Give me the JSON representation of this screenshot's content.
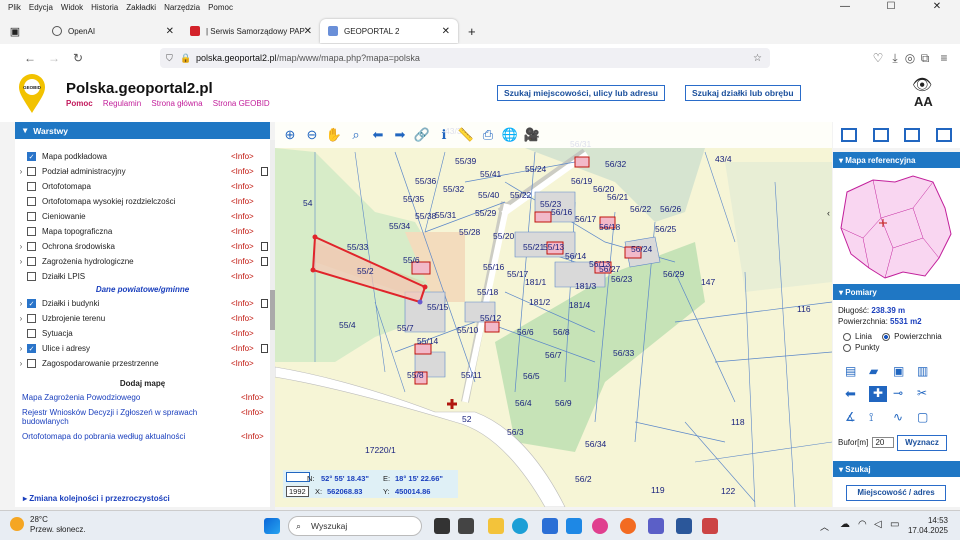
{
  "menu": [
    "Plik",
    "Edycja",
    "Widok",
    "Historia",
    "Zakładki",
    "Narzędzia",
    "Pomoc"
  ],
  "window_controls": {
    "minimize": "—",
    "maximize": "☐",
    "close": "✕"
  },
  "tabs": [
    {
      "label": "OpenAI",
      "close": "✕"
    },
    {
      "label": "| Serwis Samorządowy PAP",
      "close": "✕"
    },
    {
      "label": "GEOPORTAL 2",
      "close": "✕"
    }
  ],
  "new_tab": "+",
  "url": {
    "host": "polska.geoportal2.pl",
    "path": "/map/www/mapa.php?mapa=polska"
  },
  "header": {
    "logo_text": "GEOBID",
    "title": "Polska.geoportal2.pl",
    "links": [
      "Pomoc",
      "Regulamin",
      "Strona główna",
      "Strona GEOBID"
    ],
    "btn_search_place": "Szukaj miejscowości, ulicy lub adresu",
    "btn_search_parcel": "Szukaj działki lub obrębu",
    "font_size_label": "AA"
  },
  "layers_panel": {
    "title": "Warstwy",
    "items": [
      {
        "label": "Mapa podkładowa",
        "checked": true,
        "expand": false,
        "info": "<Info>",
        "doc": false
      },
      {
        "label": "Podział administracyjny",
        "checked": false,
        "expand": true,
        "info": "<Info>",
        "doc": true
      },
      {
        "label": "Ortofotomapa",
        "checked": false,
        "expand": false,
        "info": "<Info>",
        "doc": false
      },
      {
        "label": "Ortofotomapa wysokiej rozdzielczości",
        "checked": false,
        "expand": false,
        "info": "<Info>",
        "doc": false
      },
      {
        "label": "Cieniowanie",
        "checked": false,
        "expand": false,
        "info": "<Info>",
        "doc": false
      },
      {
        "label": "Mapa topograficzna",
        "checked": false,
        "expand": false,
        "info": "<Info>",
        "doc": false
      },
      {
        "label": "Ochrona środowiska",
        "checked": false,
        "expand": true,
        "info": "<Info>",
        "doc": true
      },
      {
        "label": "Zagrożenia hydrologiczne",
        "checked": false,
        "expand": true,
        "info": "<Info>",
        "doc": true
      },
      {
        "label": "Działki LPIS",
        "checked": false,
        "expand": false,
        "info": "<Info>",
        "doc": false
      }
    ],
    "section_county": "Dane powiatowe/gminne",
    "items2": [
      {
        "label": "Działki i budynki",
        "checked": true,
        "expand": true,
        "info": "<Info>",
        "doc": true
      },
      {
        "label": "Uzbrojenie terenu",
        "checked": false,
        "expand": true,
        "info": "<Info>",
        "doc": false
      },
      {
        "label": "Sytuacja",
        "checked": false,
        "expand": false,
        "info": "<Info>",
        "doc": false
      },
      {
        "label": "Ulice i adresy",
        "checked": true,
        "expand": true,
        "info": "<Info>",
        "doc": true
      },
      {
        "label": "Zagospodarowanie przestrzenne",
        "checked": false,
        "expand": true,
        "info": "<Info>",
        "doc": false
      }
    ],
    "add_map": "Dodaj mapę",
    "add_map_items": [
      {
        "label": "Mapa Zagrożenia Powodziowego",
        "info": "<Info>"
      },
      {
        "label": "Rejestr Wniosków Decyzji i Zgłoszeń w sprawach budowlanych",
        "info": "<Info>"
      },
      {
        "label": "Ortofotomapa do pobrania według aktualności",
        "info": "<Info>"
      }
    ],
    "change_order": "Zmiana kolejności i przezroczystości"
  },
  "map": {
    "coords": {
      "n_label": "N:",
      "n_value": "52° 55' 18.43\"",
      "e_label": "E:",
      "e_value": "18° 15' 22.66\"",
      "x_label": "X:",
      "x_value": "562068.83",
      "y_label": "Y:",
      "y_value": "450014.86",
      "system": "1992"
    },
    "parcels": [
      "43/3",
      "56/31",
      "56/32",
      "43/4",
      "55/39",
      "55/24",
      "56/20",
      "56/19",
      "55/36",
      "55/32",
      "55/41",
      "55/22",
      "55/23",
      "56/21",
      "56/22",
      "55/35",
      "55/40",
      "56/16",
      "56/17",
      "56/26",
      "54",
      "55/38",
      "55/31",
      "55/29",
      "56/18",
      "56/25",
      "55/34",
      "55/28",
      "55/20",
      "55/13",
      "56/14",
      "56/24",
      "55/33",
      "55/21",
      "56/13",
      "56/27",
      "56/29",
      "55/6",
      "55/16",
      "55/17",
      "56/23",
      "55/2",
      "55/18",
      "181/1",
      "181/3",
      "147",
      "181/2",
      "55/4",
      "55/15",
      "181/4",
      "116",
      "55/7",
      "55/12",
      "55/10",
      "56/6",
      "56/8",
      "55/14",
      "56/7",
      "56/33",
      "55/11",
      "56/5",
      "55/8",
      "56/4",
      "56/9",
      "118",
      "52",
      "56/3",
      "17220/1",
      "56/34",
      "119",
      "56/2",
      "122"
    ]
  },
  "right_panel": {
    "ref_map_title": "Mapa referencyjna",
    "measures_title": "Pomiary",
    "length_label": "Długość:",
    "length_value": "238.39 m",
    "area_label": "Powierzchnia:",
    "area_value": "5531 m2",
    "mode_line": "Linia",
    "mode_area": "Powierzchnia",
    "mode_points": "Punkty",
    "buffer_label": "Bufor[m]",
    "buffer_value": "20",
    "draw_btn": "Wyznacz",
    "search_title": "Szukaj",
    "search_btn": "Miejscowość / adres"
  },
  "taskbar": {
    "temp": "28°C",
    "weather": "Przew. słonecz.",
    "search_placeholder": "Wyszukaj",
    "time": "14:53",
    "date": "17.04.2025"
  },
  "colors": {
    "accent": "#1f77c4",
    "link": "#c21f9b",
    "info": "#c0140c",
    "parcel_text": "#1a237e"
  }
}
